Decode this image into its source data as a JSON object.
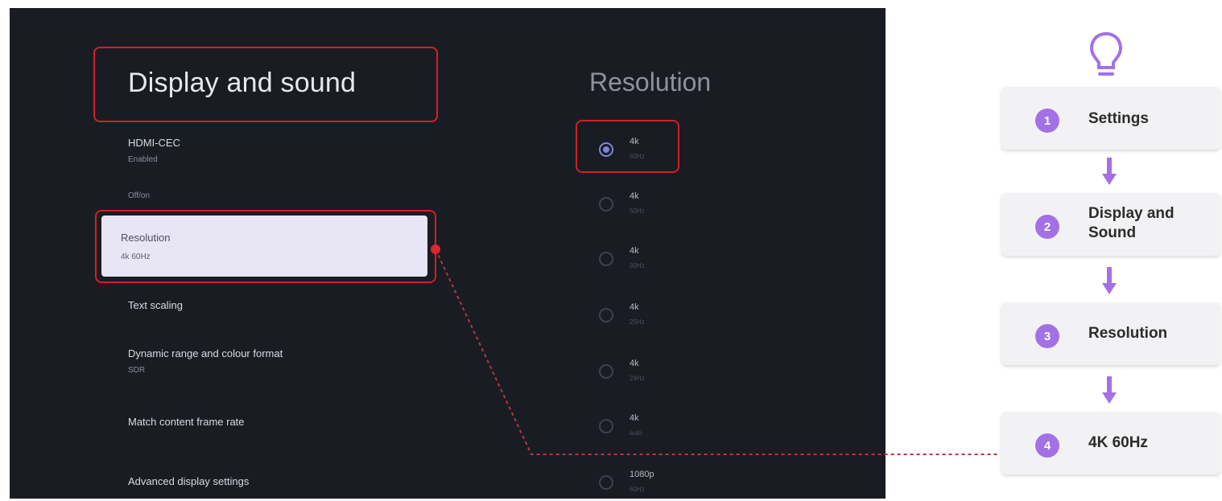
{
  "tv": {
    "title": "Display and sound",
    "menu": [
      {
        "label": "HDMI-CEC",
        "sub": "Enabled"
      },
      {
        "label": "",
        "sub": "Off/on"
      },
      {
        "label": "Resolution",
        "sub": "4k 60Hz"
      },
      {
        "label": "Text scaling",
        "sub": ""
      },
      {
        "label": "Dynamic range and colour format",
        "sub": "SDR"
      },
      {
        "label": "Match content frame rate",
        "sub": ""
      },
      {
        "label": "Advanced display settings",
        "sub": ""
      }
    ],
    "resolution_title": "Resolution",
    "options": [
      {
        "l1": "4k",
        "l2": "60Hz",
        "selected": true
      },
      {
        "l1": "4k",
        "l2": "50Hz",
        "selected": false
      },
      {
        "l1": "4k",
        "l2": "30Hz",
        "selected": false
      },
      {
        "l1": "4k",
        "l2": "25Hz",
        "selected": false
      },
      {
        "l1": "4k",
        "l2": "24Hz",
        "selected": false
      },
      {
        "l1": "4k",
        "l2": "auto",
        "selected": false
      },
      {
        "l1": "1080p",
        "l2": "60Hz",
        "selected": false
      }
    ],
    "colors": {
      "highlight": "#d51f26",
      "background": "#1a1c24",
      "radio_on": "#7a86d8"
    }
  },
  "steps": {
    "icon": "lightbulb-icon",
    "items": [
      {
        "num": "1",
        "label": "Settings"
      },
      {
        "num": "2",
        "label": "Display and Sound"
      },
      {
        "num": "3",
        "label": "Resolution"
      },
      {
        "num": "4",
        "label": "4K 60Hz"
      }
    ],
    "colors": {
      "accent": "#a271e6"
    }
  }
}
